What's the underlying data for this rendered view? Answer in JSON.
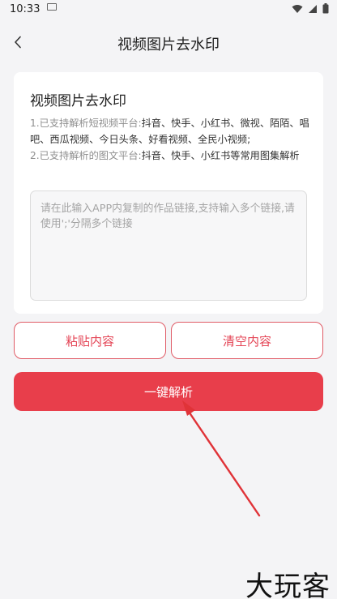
{
  "status_bar": {
    "time": "10:33",
    "icons": [
      "notification-icon",
      "wifi-icon",
      "signal-icon",
      "battery-icon"
    ]
  },
  "nav": {
    "back_icon": "chevron-left-icon",
    "title": "视频图片去水印"
  },
  "card": {
    "title": "视频图片去水印",
    "notes": [
      {
        "prefix": "1.已支持解析短视频平台:",
        "platforms": "抖音、快手、小红书、微视、陌陌、唱吧、西瓜视频、今日头条、好看视频、全民小视频;"
      },
      {
        "prefix": "2.已支持解析的图文平台:",
        "platforms": "抖音、快手、小红书等常用图集解析"
      }
    ],
    "input": {
      "value": "",
      "placeholder": "请在此输入APP内复制的作品链接,支持输入多个链接,请使用';'分隔多个链接"
    }
  },
  "actions": {
    "paste_label": "粘贴内容",
    "clear_label": "清空内容",
    "parse_label": "一键解析"
  },
  "annotation": {
    "color": "#e03338"
  },
  "watermark": {
    "text": "大玩客"
  },
  "colors": {
    "accent": "#e83e4b",
    "background": "#f4f4f6"
  }
}
